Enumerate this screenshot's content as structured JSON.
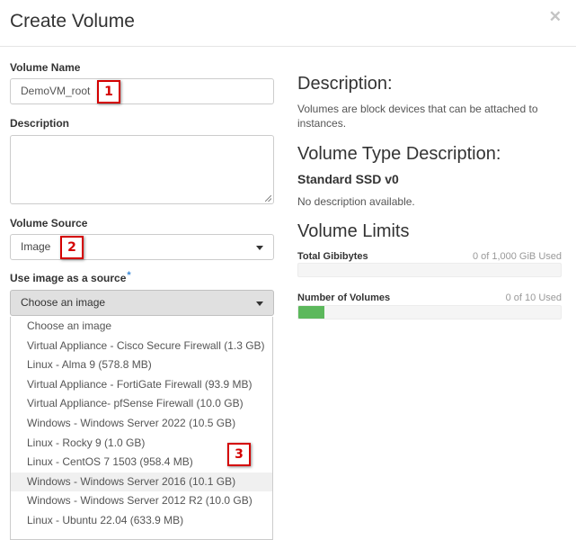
{
  "header": {
    "title": "Create Volume",
    "close_glyph": "✕"
  },
  "form": {
    "volume_name": {
      "label": "Volume Name",
      "value": "DemoVM_root"
    },
    "description": {
      "label": "Description",
      "value": ""
    },
    "volume_source": {
      "label": "Volume Source",
      "value": "Image"
    },
    "image_source": {
      "label": "Use image as a source",
      "required_mark": "*",
      "value": "Choose an image",
      "options": [
        "Choose an image",
        "Virtual Appliance - Cisco Secure Firewall (1.3 GB)",
        "Linux - Alma 9 (578.8 MB)",
        "Virtual Appliance - FortiGate Firewall (93.9 MB)",
        "Virtual Appliance- pfSense Firewall (10.0 GB)",
        "Windows - Windows Server 2022 (10.5 GB)",
        "Linux - Rocky 9 (1.0 GB)",
        "Linux - CentOS 7 1503 (958.4 MB)",
        "Windows - Windows Server 2016 (10.1 GB)",
        "Windows - Windows Server 2012 R2 (10.0 GB)",
        "Linux - Ubuntu 22.04 (633.9 MB)"
      ],
      "highlighted_index": 8
    }
  },
  "annotations": [
    "1",
    "2",
    "3"
  ],
  "info": {
    "description_heading": "Description:",
    "description_text": "Volumes are block devices that can be attached to instances.",
    "type_heading": "Volume Type Description:",
    "type_name": "Standard SSD v0",
    "type_text": "No description available.",
    "limits_heading": "Volume Limits",
    "limits": [
      {
        "label": "Total Gibibytes",
        "used_text": "0 of 1,000 GiB Used",
        "fraction": 0.0
      },
      {
        "label": "Number of Volumes",
        "used_text": "0 of 10 Used",
        "fraction": 0.1
      }
    ]
  },
  "colors": {
    "badge": "#d40000",
    "progress_fill": "#5cb85c",
    "required_mark": "#3d8bd8"
  }
}
